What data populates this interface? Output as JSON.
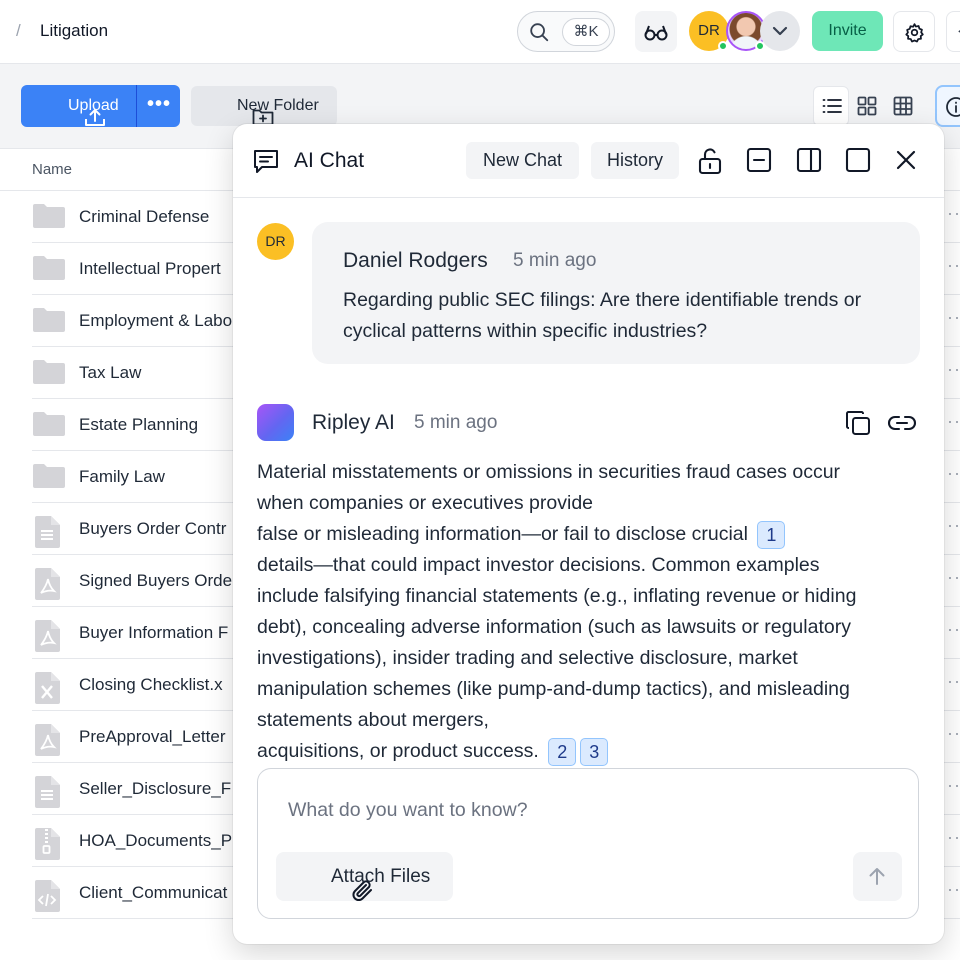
{
  "topbar": {
    "breadcrumb_separator": "/",
    "title": "Litigation",
    "search_shortcut": "⌘K",
    "user_initials": "DR",
    "invite_label": "Invite",
    "edge_glyph": "←"
  },
  "toolbar": {
    "upload_label": "Upload",
    "more_label": "•••",
    "new_folder_label": "New Folder"
  },
  "file_list": {
    "column_name": "Name",
    "row_menu": "···",
    "rows": [
      {
        "name": "Criminal Defense",
        "type": "folder"
      },
      {
        "name": "Intellectual Propert",
        "type": "folder"
      },
      {
        "name": "Employment & Labo",
        "type": "folder"
      },
      {
        "name": "Tax Law",
        "type": "folder"
      },
      {
        "name": "Estate Planning",
        "type": "folder"
      },
      {
        "name": "Family Law",
        "type": "folder"
      },
      {
        "name": "Buyers Order Contr",
        "type": "doc"
      },
      {
        "name": "Signed Buyers Orde",
        "type": "pdf"
      },
      {
        "name": "Buyer Information F",
        "type": "pdf"
      },
      {
        "name": "Closing Checklist.x",
        "type": "xls"
      },
      {
        "name": "PreApproval_Letter",
        "type": "pdf"
      },
      {
        "name": "Seller_Disclosure_F",
        "type": "doc"
      },
      {
        "name": "HOA_Documents_P",
        "type": "zip"
      },
      {
        "name": "Client_Communicat",
        "type": "code"
      }
    ]
  },
  "chat": {
    "title": "AI Chat",
    "new_chat_label": "New Chat",
    "history_label": "History",
    "user_message": {
      "initials": "DR",
      "author": "Daniel Rodgers",
      "time": "5 min ago",
      "text": "Regarding public SEC filings: Are there identifiable trends or cyclical patterns within specific industries?"
    },
    "ai_message": {
      "author": "Ripley AI",
      "time": "5 min ago",
      "lines": [
        "Material misstatements or omissions in securities fraud cases occur",
        "when companies or executives provide",
        "false or misleading information—or fail to disclose crucial",
        "details—that could impact investor decisions. Common examples",
        "include falsifying financial statements (e.g., inflating revenue or hiding",
        "debt), concealing adverse information (such as lawsuits or regulatory",
        "investigations), insider trading and selective disclosure, market",
        "manipulation schemes (like pump-and-dump tactics), and misleading",
        "statements about mergers,",
        "acquisitions, or product success."
      ],
      "citations": [
        "1",
        "2",
        "3"
      ]
    },
    "composer": {
      "placeholder": "What do you want to know?",
      "value": "",
      "attach_label": "Attach Files"
    }
  },
  "colors": {
    "accent_blue": "#3b82f6",
    "invite_green": "#6ee7b7",
    "avatar_yellow": "#fbbf24",
    "citation_bg": "#dbeafe"
  },
  "icons": [
    "search-icon",
    "glasses-icon",
    "chevron-down-icon",
    "gear-icon",
    "upload-icon",
    "folder-plus-icon",
    "list-view-icon",
    "grid-view-icon",
    "table-view-icon",
    "info-icon",
    "folder-icon",
    "file-icon",
    "pdf-file-icon",
    "excel-file-icon",
    "zip-file-icon",
    "code-file-icon",
    "chat-icon",
    "unlock-icon",
    "minimize-icon",
    "side-panel-icon",
    "maximize-icon",
    "close-icon",
    "copy-icon",
    "link-icon",
    "paperclip-icon",
    "arrow-up-icon"
  ]
}
